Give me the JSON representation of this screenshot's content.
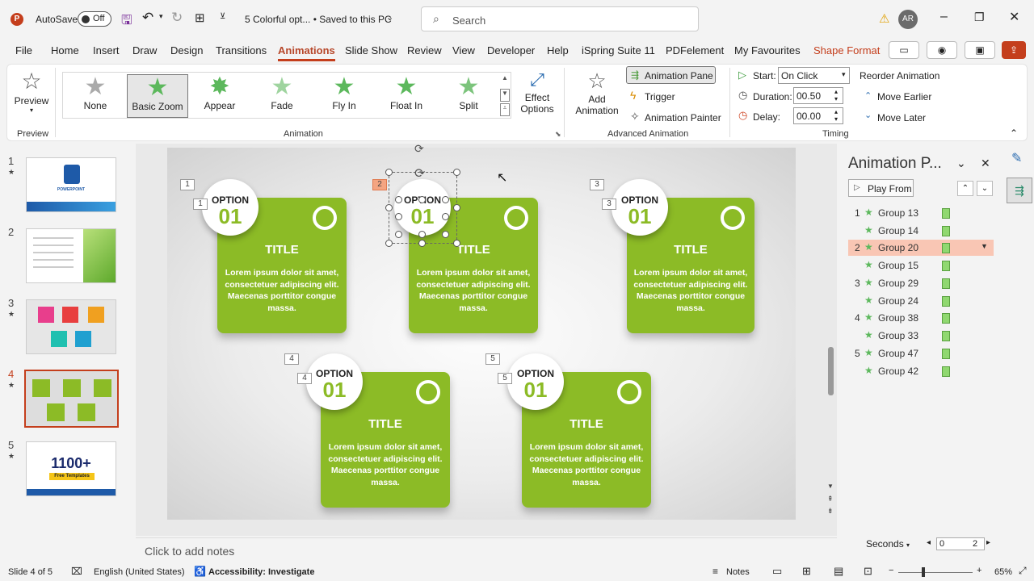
{
  "titlebar": {
    "autosave_label": "AutoSave",
    "autosave_state": "Off",
    "doc_title": "5 Colorful opt... • Saved to this PC",
    "search_placeholder": "Search",
    "avatar_initials": "AR"
  },
  "tabs": [
    "File",
    "Home",
    "Insert",
    "Draw",
    "Design",
    "Transitions",
    "Animations",
    "Slide Show",
    "Review",
    "View",
    "Developer",
    "Help",
    "iSpring Suite 11",
    "PDFelement",
    "My Favourites",
    "Shape Format"
  ],
  "ribbon": {
    "preview_label": "Preview",
    "preview_group": "Preview",
    "gallery": [
      "None",
      "Basic Zoom",
      "Appear",
      "Fade",
      "Fly In",
      "Float In",
      "Split"
    ],
    "effect_options_line1": "Effect",
    "effect_options_line2": "Options",
    "animation_group": "Animation",
    "add_animation_line1": "Add",
    "add_animation_line2": "Animation",
    "animation_pane_btn": "Animation Pane",
    "trigger_btn": "Trigger",
    "animation_painter_btn": "Animation Painter",
    "advanced_group": "Advanced Animation",
    "start_label": "Start:",
    "start_value": "On Click",
    "duration_label": "Duration:",
    "duration_value": "00.50",
    "delay_label": "Delay:",
    "delay_value": "00.00",
    "timing_group": "Timing",
    "reorder_title": "Reorder Animation",
    "move_earlier": "Move Earlier",
    "move_later": "Move Later"
  },
  "thumbnails": [
    {
      "num": "1",
      "star": "★",
      "thumb_text": "POWERPOINT"
    },
    {
      "num": "2",
      "star": "",
      "thumb_text": ""
    },
    {
      "num": "3",
      "star": "★",
      "thumb_text": ""
    },
    {
      "num": "4",
      "star": "★",
      "thumb_text": ""
    },
    {
      "num": "5",
      "star": "★",
      "thumb_text": "1100+",
      "thumb_sub": "Free Templates"
    }
  ],
  "slide": {
    "cards": [
      {
        "tag": "1",
        "inner_tag": "1",
        "option": "OPTION",
        "number": "01",
        "title": "TITLE",
        "body": "Lorem ipsum dolor sit amet, consectetuer adipiscing elit. Maecenas porttitor congue massa."
      },
      {
        "tag": "2",
        "inner_tag": "",
        "option": "OPTION",
        "number": "01",
        "title": "TITLE",
        "body": "Lorem ipsum dolor sit amet, consectetuer adipiscing elit. Maecenas porttitor congue massa."
      },
      {
        "tag": "3",
        "inner_tag": "3",
        "option": "OPTION",
        "number": "01",
        "title": "TITLE",
        "body": "Lorem ipsum dolor sit amet, consectetuer adipiscing elit. Maecenas porttitor congue massa."
      },
      {
        "tag": "4",
        "inner_tag": "4",
        "option": "OPTION",
        "number": "01",
        "title": "TITLE",
        "body": "Lorem ipsum dolor sit amet, consectetuer adipiscing elit. Maecenas porttitor congue massa."
      },
      {
        "tag": "5",
        "inner_tag": "5",
        "option": "OPTION",
        "number": "01",
        "title": "TITLE",
        "body": "Lorem ipsum dolor sit amet, consectetuer adipiscing elit. Maecenas porttitor congue massa."
      }
    ],
    "accent_color": "#8cbb26"
  },
  "notes_placeholder": "Click to add notes",
  "anim_pane": {
    "title": "Animation P...",
    "play_from": "Play From",
    "items": [
      {
        "n": "1",
        "name": "Group 13",
        "selected": false
      },
      {
        "n": "",
        "name": "Group 14",
        "selected": false
      },
      {
        "n": "2",
        "name": "Group 20",
        "selected": true
      },
      {
        "n": "",
        "name": "Group 15",
        "selected": false
      },
      {
        "n": "3",
        "name": "Group 29",
        "selected": false
      },
      {
        "n": "",
        "name": "Group 24",
        "selected": false
      },
      {
        "n": "4",
        "name": "Group 38",
        "selected": false
      },
      {
        "n": "",
        "name": "Group 33",
        "selected": false
      },
      {
        "n": "5",
        "name": "Group 47",
        "selected": false
      },
      {
        "n": "",
        "name": "Group 42",
        "selected": false
      }
    ],
    "seconds_label": "Seconds",
    "timeline_start": "0",
    "timeline_end": "2"
  },
  "status": {
    "slide_info": "Slide 4 of 5",
    "language": "English (United States)",
    "accessibility": "Accessibility: Investigate",
    "notes_btn": "Notes",
    "zoom": "65%"
  }
}
